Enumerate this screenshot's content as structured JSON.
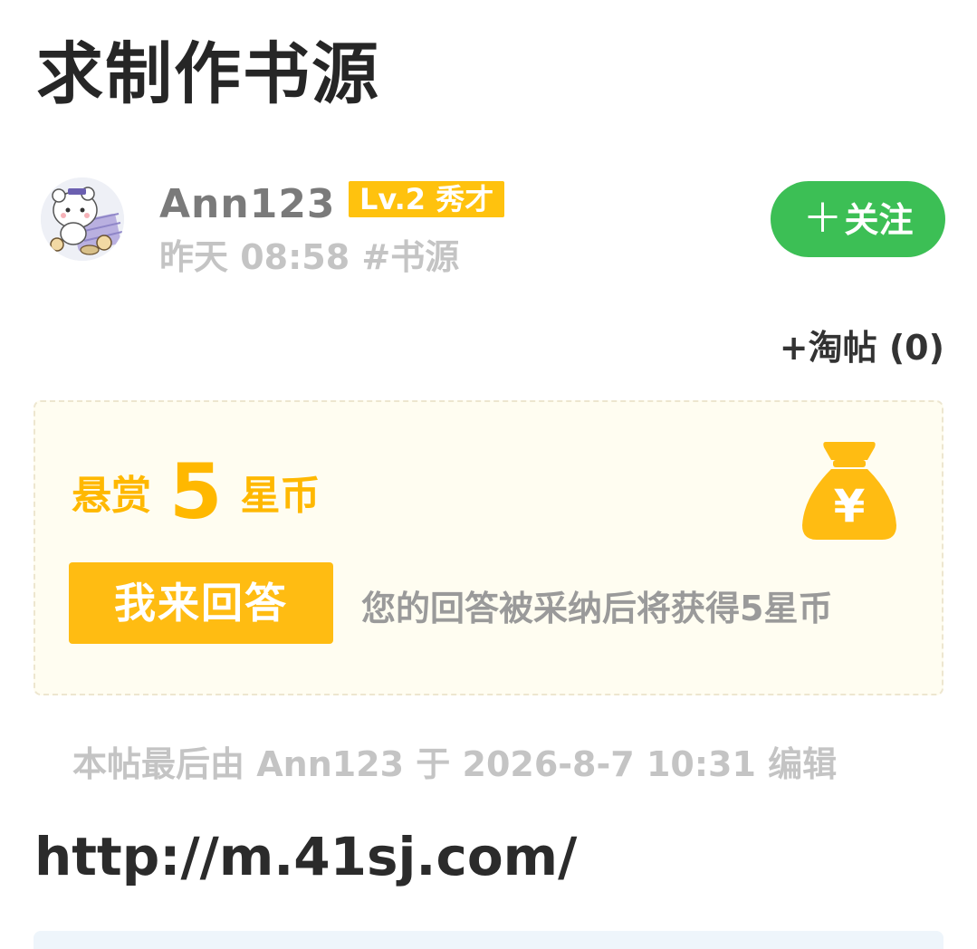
{
  "post": {
    "title": "求制作书源",
    "body_link": "http://m.41sj.com/",
    "edit_note": "本帖最后由 Ann123 于 2026-8-7 10:31 编辑",
    "tao_tie_label": "+淘帖 (0)"
  },
  "author": {
    "name": "Ann123",
    "level_badge": "Lv.2 秀才",
    "meta": "昨天 08:58 #书源",
    "follow_plus": "＋",
    "follow_label": "关注",
    "avatar_icon": "hamster-avatar-icon"
  },
  "reward": {
    "prefix": "悬赏",
    "amount": "5",
    "unit": "星币",
    "answer_button": "我来回答",
    "hint": "您的回答被采纳后将获得5星币",
    "bag_icon": "money-bag-icon",
    "bag_symbol": "¥"
  },
  "colors": {
    "follow_green": "#3cbf55",
    "reward_gold": "#ffb800",
    "badge_gold": "#ffc20e",
    "card_background": "#fffdf1",
    "muted_gray": "#c4c4c4"
  }
}
